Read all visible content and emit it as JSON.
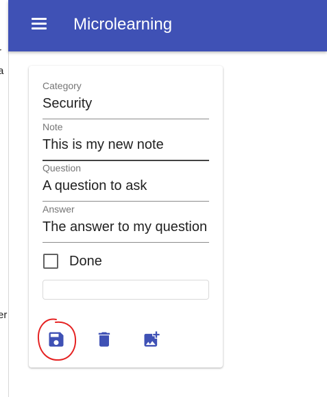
{
  "app": {
    "title": "Microlearning"
  },
  "left_fragments": [
    "r",
    "a",
    "er"
  ],
  "form": {
    "fields": [
      {
        "label": "Category",
        "value": "Security"
      },
      {
        "label": "Note",
        "value": "This is my new note"
      },
      {
        "label": "Question",
        "value": "A question to ask"
      },
      {
        "label": "Answer",
        "value": "The answer to my question"
      }
    ],
    "done_label": "Done",
    "done_checked": false,
    "extra_input_value": ""
  },
  "actions": [
    {
      "icon": "save-icon"
    },
    {
      "icon": "delete-icon"
    },
    {
      "icon": "add-photo-icon"
    }
  ],
  "colors": {
    "app_bar": "#3f51b5",
    "action_icon": "#3f51b5",
    "annotation": "#e52222"
  }
}
